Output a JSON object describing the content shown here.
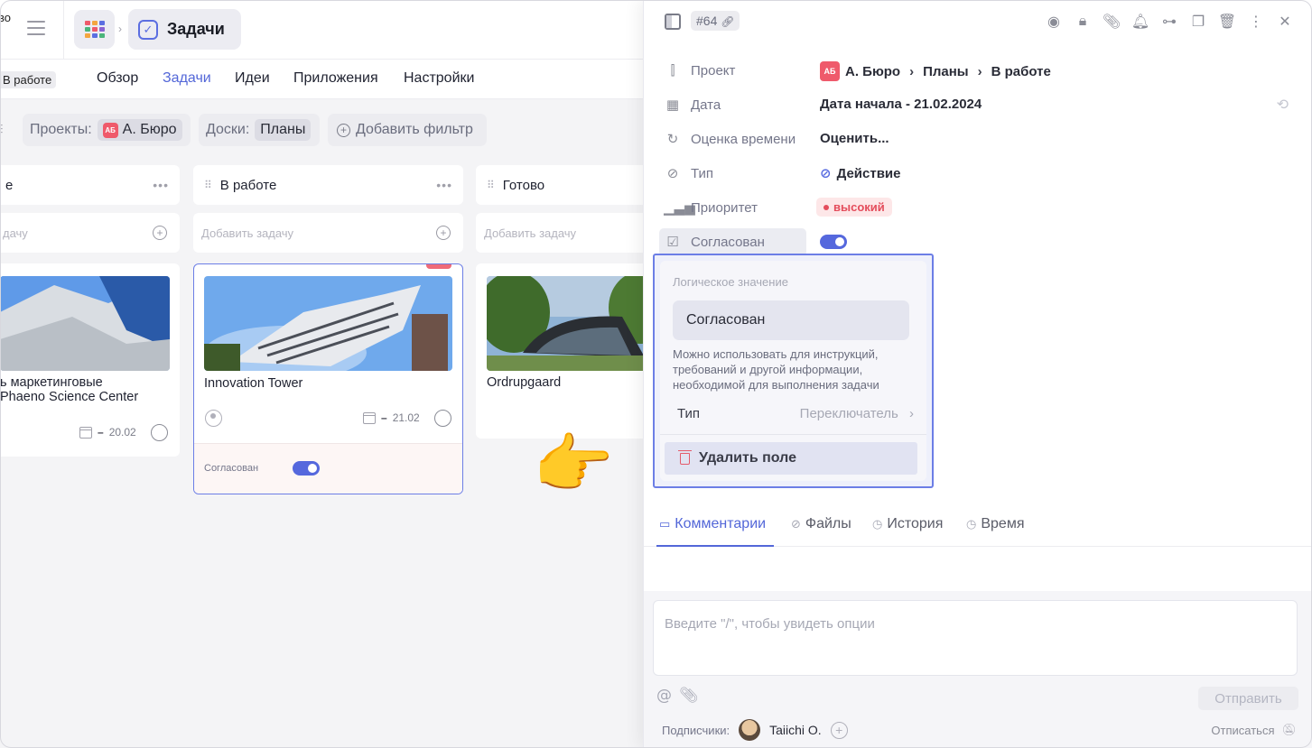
{
  "topbar": {
    "corner_text": "во",
    "section_title": "Задачи",
    "app_grid_colors": [
      "#ef5a6b",
      "#f4a640",
      "#5b6ee1",
      "#4bb57b",
      "#ef5a6b",
      "#8a63d2",
      "#f4a640",
      "#5b6ee1",
      "#4bb57b"
    ]
  },
  "nav": {
    "status_tag": "В работе",
    "tabs": [
      {
        "label": "Обзор",
        "active": false
      },
      {
        "label": "Задачи",
        "active": true
      },
      {
        "label": "Идеи",
        "active": false
      },
      {
        "label": "Приложения",
        "active": false
      },
      {
        "label": "Настройки",
        "active": false
      }
    ]
  },
  "filters": {
    "projects_label": "Проекты:",
    "projects_avatar": "АБ",
    "projects_value": "А. Бюро",
    "boards_label": "Доски:",
    "boards_value": "Планы",
    "add_filter": "Добавить фильтр"
  },
  "columns": [
    {
      "title": "е",
      "add_placeholder": "дачу"
    },
    {
      "title": "В работе",
      "add_placeholder": "Добавить задачу"
    },
    {
      "title": "Готово",
      "add_placeholder": "Добавить задачу"
    }
  ],
  "cards": [
    {
      "title_line1": "ь маркетинговые",
      "title_line2": "Phaeno Science Center",
      "date": "20.02"
    },
    {
      "title": "Innovation Tower",
      "date": "21.02",
      "field_label": "Согласован",
      "field_on": true
    },
    {
      "title": "Ordrupgaard"
    }
  ],
  "panel": {
    "task_id": "#64",
    "properties": [
      {
        "icon": "project-icon",
        "label": "Проект",
        "avatar": "АБ",
        "path": [
          "А. Бюро",
          "Планы",
          "В работе"
        ]
      },
      {
        "icon": "calendar-icon",
        "label": "Дата",
        "value": "Дата начала  -  21.02.2024"
      },
      {
        "icon": "clock-icon",
        "label": "Оценка времени",
        "value": "Оценить..."
      },
      {
        "icon": "type-icon",
        "label": "Тип",
        "value": "Действие"
      },
      {
        "icon": "priority-icon",
        "label": "Приоритет",
        "value": "высокий"
      },
      {
        "icon": "checkbox-icon",
        "label": "Согласован",
        "on": true
      }
    ],
    "popover": {
      "caption": "Логическое значение",
      "name_value": "Согласован",
      "description": "Можно использовать для инструкций, требований и другой информации, необходимой для выполнения задачи",
      "type_label": "Тип",
      "type_value": "Переключатель",
      "delete_label": "Удалить поле"
    },
    "tabs": [
      {
        "label": "Комментарии",
        "active": true,
        "icon": "comment-icon"
      },
      {
        "label": "Файлы",
        "active": false,
        "icon": "paperclip-icon"
      },
      {
        "label": "История",
        "active": false,
        "icon": "history-icon"
      },
      {
        "label": "Время",
        "active": false,
        "icon": "timer-icon"
      }
    ],
    "comment_placeholder": "Введите \"/\", чтобы увидеть опции",
    "send_label": "Отправить",
    "subscribers_label": "Подписчики:",
    "subscriber_name": "Taiichi O.",
    "unsubscribe_label": "Отписаться"
  },
  "colors": {
    "accent": "#5367d8",
    "danger": "#e44d5c",
    "popover_border": "#6c7ee6"
  }
}
